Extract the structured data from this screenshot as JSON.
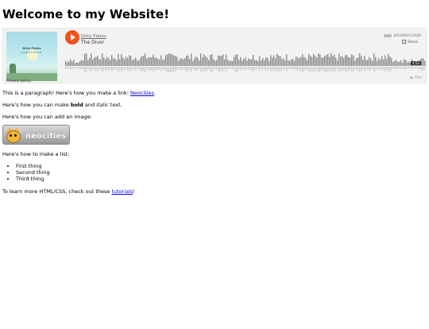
{
  "page": {
    "heading": "Welcome to my Website!",
    "widget": {
      "artist": "Dirty Plates",
      "track": "The Diver",
      "album_title": "Dirty Plates",
      "album_sub": "TEMPTRESS",
      "privacy": "Privacy policy",
      "soundcloud_label": "SOUNDCLOUD",
      "share_label": "Share",
      "duration": "4:52",
      "plays": "▶ 794"
    },
    "para1_before": "This is a paragraph! Here's how you make a link: ",
    "para1_link": "Neocities",
    "para1_after": ".",
    "para2_before": "Here's how you can make ",
    "para2_bold": "bold",
    "para2_mid": " and ",
    "para2_italic": "italic",
    "para2_after": " text.",
    "para3": "Here's how you can add an image:",
    "badge": {
      "hosted": "hosted by",
      "brand": "neocities"
    },
    "para4": "Here's how to make a list:",
    "list": [
      "First thing",
      "Second thing",
      "Third thing"
    ],
    "para5_before": "To learn more HTML/CSS, check out these ",
    "para5_link": "tutorials",
    "para5_after": "!"
  }
}
